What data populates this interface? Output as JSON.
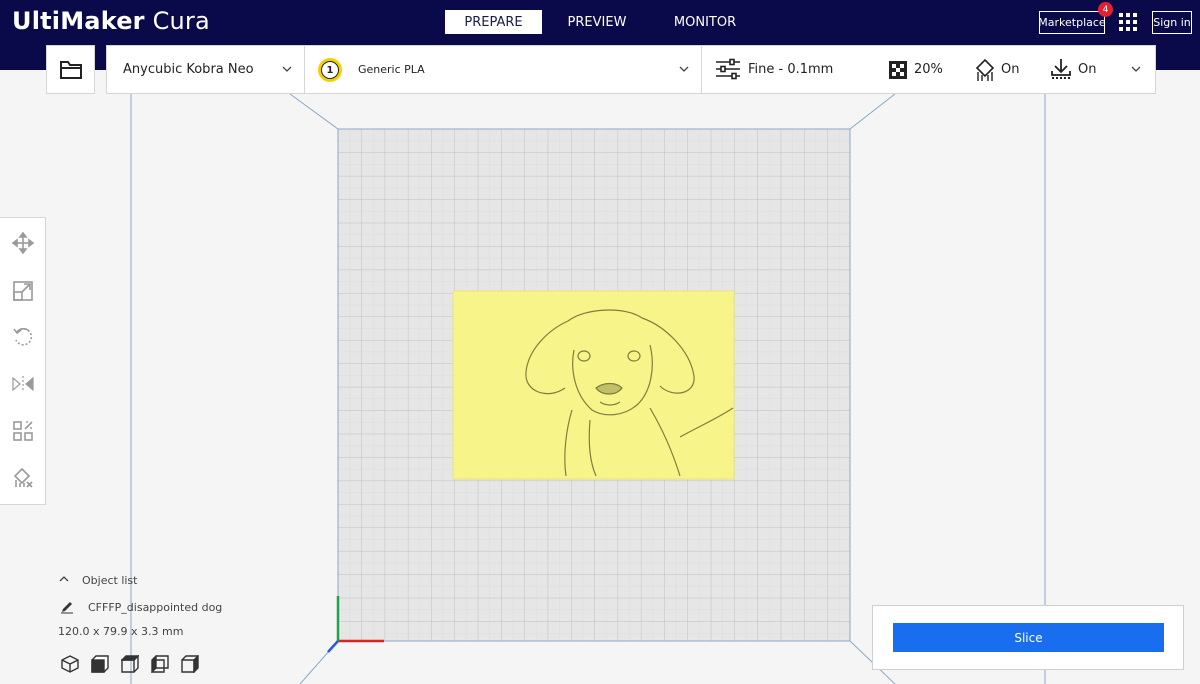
{
  "app": {
    "logo_bold": "UltiMaker",
    "logo_light": " Cura"
  },
  "stages": {
    "prepare": "PREPARE",
    "preview": "PREVIEW",
    "monitor": "MONITOR",
    "active": "PREPARE"
  },
  "header_right": {
    "marketplace_label": "Marketplace",
    "marketplace_badge": "4",
    "signin_label": "Sign in"
  },
  "toolbar": {
    "printer_name": "Anycubic Kobra Neo",
    "extruder_number": "1",
    "material_name": "Generic PLA",
    "profile_label": "Fine - 0.1mm",
    "infill_label": "20%",
    "support_label": "On",
    "adhesion_label": "On"
  },
  "tools": {
    "items": [
      "move-tool",
      "scale-tool",
      "rotate-tool",
      "mirror-tool",
      "per-model-settings-tool",
      "support-blocker-tool"
    ]
  },
  "object_list": {
    "header_label": "Object list",
    "object_name": "CFFFP_disappointed dog",
    "dimensions": "120.0 x 79.9 x 3.3 mm"
  },
  "slice": {
    "button_label": "Slice"
  },
  "colors": {
    "header_bg": "#0a0a4a",
    "accent_blue": "#196ef0",
    "badge_red": "#e2202f",
    "model_yellow": "#f7f48a"
  }
}
